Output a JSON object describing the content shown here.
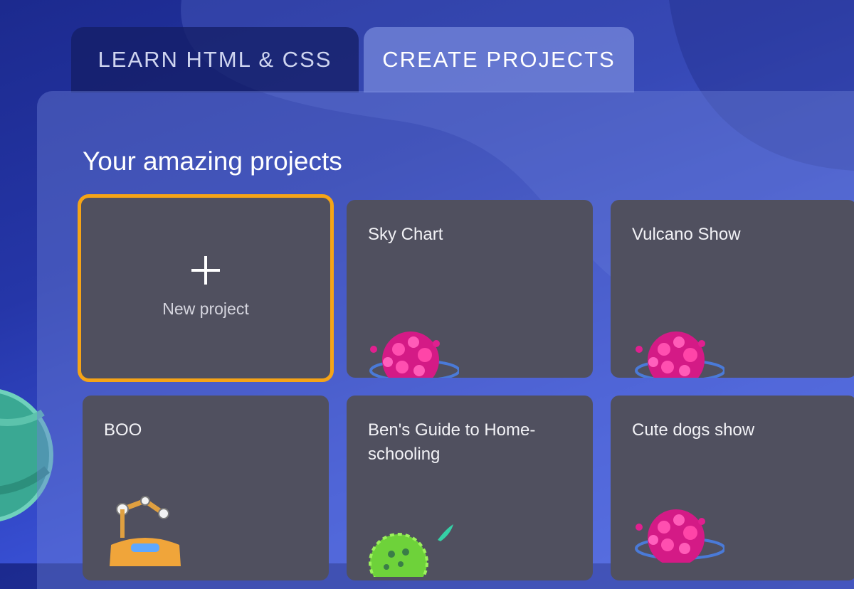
{
  "tabs": [
    {
      "label": "LEARN HTML & CSS",
      "active": false
    },
    {
      "label": "CREATE PROJECTS",
      "active": true
    }
  ],
  "section": {
    "title": "Your amazing projects"
  },
  "new_project": {
    "label": "New project",
    "icon": "plus-icon"
  },
  "projects": [
    {
      "title": "Sky Chart",
      "thumbnail": "pink-planet-icon"
    },
    {
      "title": "Vulcano Show",
      "thumbnail": "pink-planet-icon"
    },
    {
      "title": "BOO",
      "thumbnail": "robot-icon"
    },
    {
      "title": "Ben's Guide to Home-schooling",
      "thumbnail": "green-planet-icon"
    },
    {
      "title": "Cute dogs show",
      "thumbnail": "pink-planet-icon"
    }
  ],
  "colors": {
    "accent": "#f5a417",
    "card": "#50505f",
    "background": "#2536a8"
  }
}
